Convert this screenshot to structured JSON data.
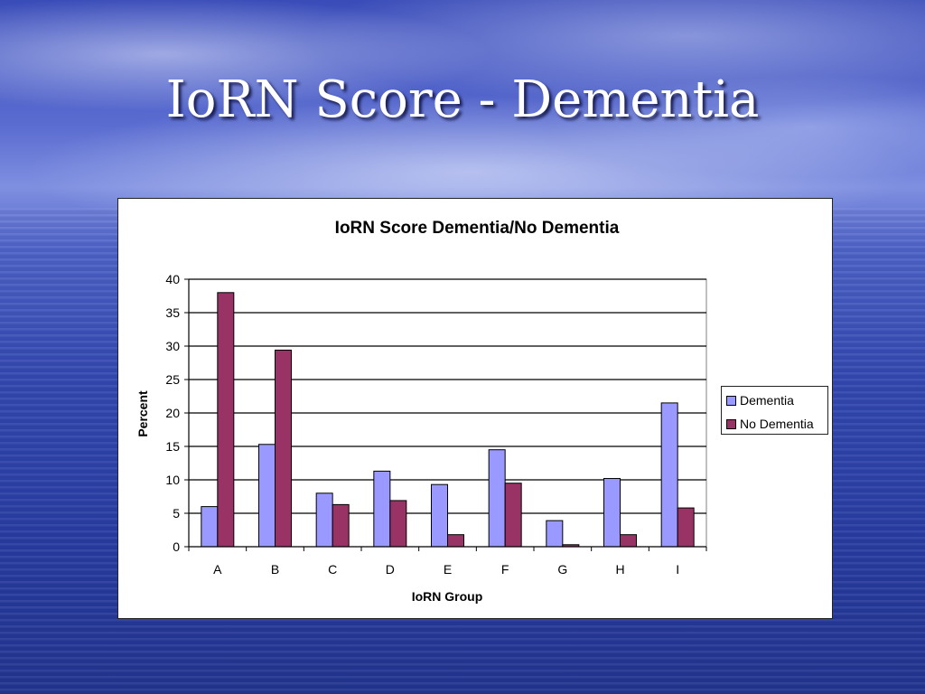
{
  "slide": {
    "title": "IoRN Score - Dementia"
  },
  "colors": {
    "dementia": "#9999ff",
    "no_dementia": "#993366"
  },
  "chart_data": {
    "type": "bar",
    "title": "IoRN Score Dementia/No Dementia",
    "xlabel": "IoRN Group",
    "ylabel": "Percent",
    "categories": [
      "A",
      "B",
      "C",
      "D",
      "E",
      "F",
      "G",
      "H",
      "I"
    ],
    "series": [
      {
        "name": "Dementia",
        "values": [
          6.0,
          15.3,
          8.0,
          11.3,
          9.3,
          14.5,
          3.9,
          10.2,
          21.5
        ]
      },
      {
        "name": "No Dementia",
        "values": [
          38.0,
          29.4,
          6.3,
          6.9,
          1.8,
          9.5,
          0.3,
          1.8,
          5.8
        ]
      }
    ],
    "ylim": [
      0,
      40
    ],
    "yticks": [
      0,
      5,
      10,
      15,
      20,
      25,
      30,
      35,
      40
    ],
    "grid": true,
    "legend": "right"
  }
}
